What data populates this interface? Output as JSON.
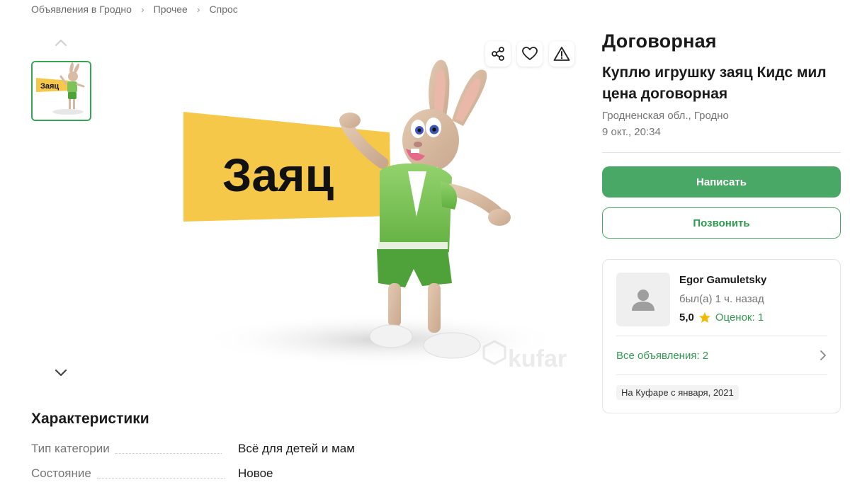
{
  "breadcrumb": [
    "Объявления в Гродно",
    "Прочее",
    "Спрос"
  ],
  "gallery": {
    "banner_text": "Заяц",
    "watermark": "kufar",
    "banner_color": "#f5c84a",
    "thumb_border_color": "#36a554"
  },
  "listing": {
    "price": "Договорная",
    "title": "Куплю игрушку заяц Кидс мил цена договорная",
    "location": "Гродненская обл., Гродно",
    "date": "9 окт., 20:34"
  },
  "actions": {
    "share_icon": "share-icon",
    "favorite_icon": "heart-icon",
    "report_icon": "warning-icon",
    "write_label": "Написать",
    "call_label": "Позвонить",
    "accent_color": "#49a865"
  },
  "seller": {
    "name": "Egor Gamuletsky",
    "last_seen": "был(а) 1 ч. назад",
    "rating": "5,0",
    "reviews": "Оценок: 1",
    "all_ads": "Все объявления: 2",
    "since": "На Куфаре с января, 2021"
  },
  "characteristics": {
    "title": "Характеристики",
    "rows": [
      {
        "key": "Тип категории",
        "value": "Всё для детей и мам"
      },
      {
        "key": "Состояние",
        "value": "Новое"
      }
    ]
  }
}
